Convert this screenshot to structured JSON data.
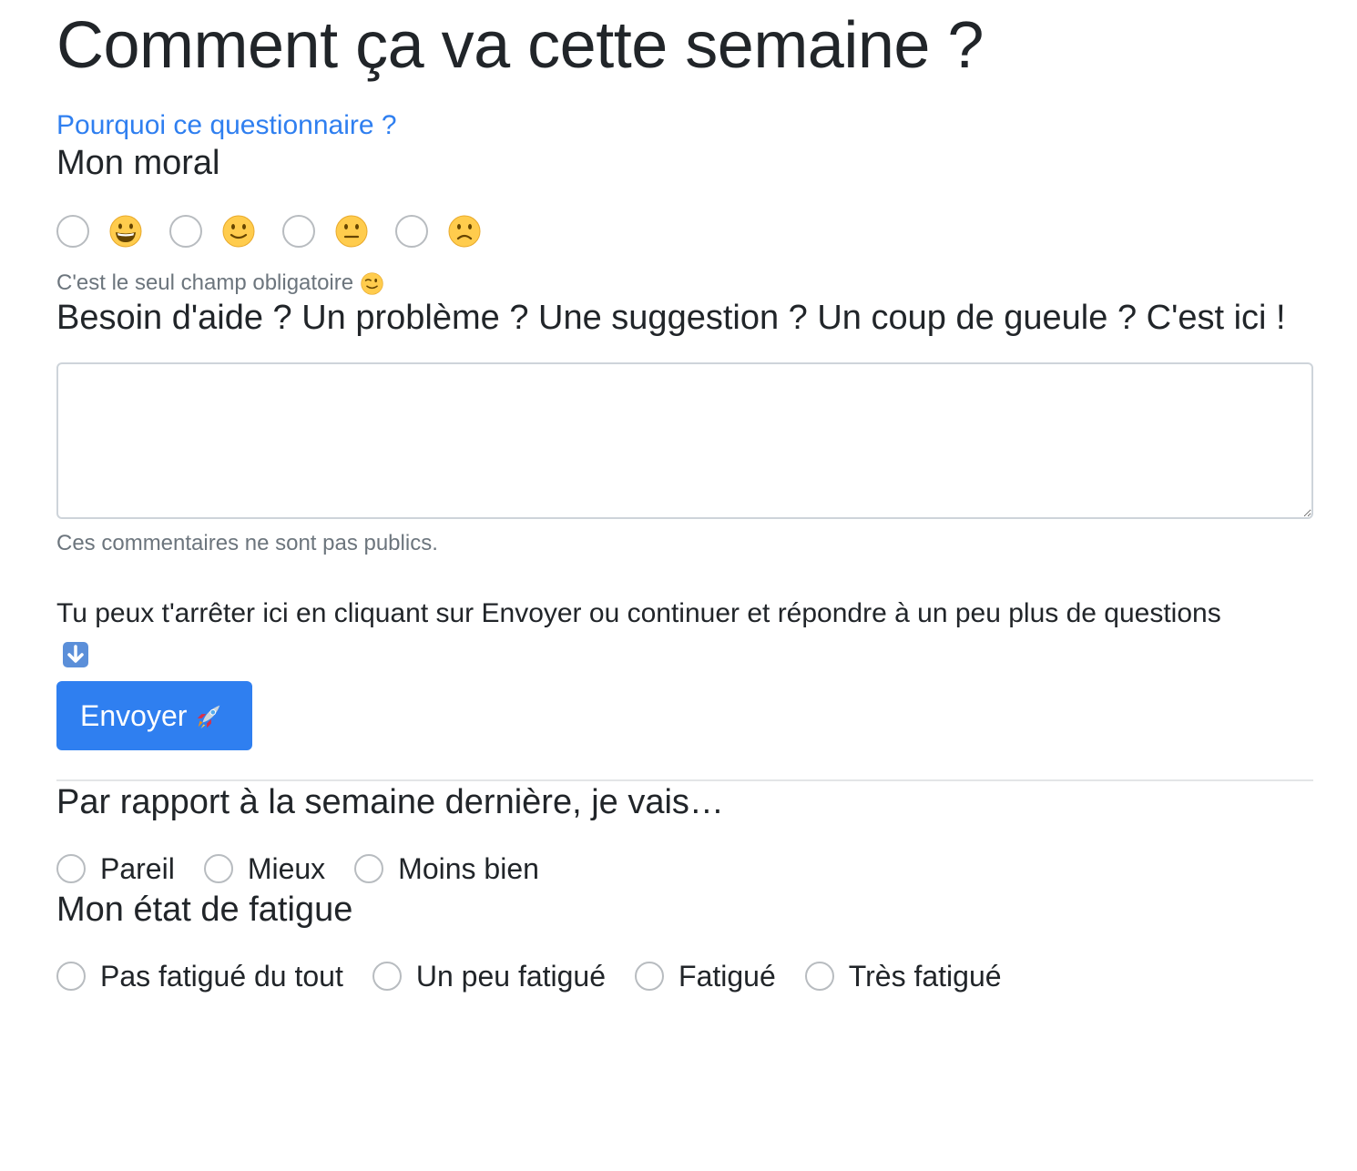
{
  "page": {
    "title": "Comment ça va cette semaine ?",
    "why_link": "Pourquoi ce questionnaire ?"
  },
  "moral": {
    "heading": "Mon moral",
    "options": [
      {
        "icon": "grinning-face-icon"
      },
      {
        "icon": "slightly-smiling-face-icon"
      },
      {
        "icon": "neutral-face-icon"
      },
      {
        "icon": "slightly-frowning-face-icon"
      }
    ],
    "help_text": "C'est le seul champ obligatoire",
    "help_icon": "winking-face-icon"
  },
  "feedback": {
    "heading": "Besoin d'aide ? Un problème ? Une suggestion ? Un coup de gueule ? C'est ici !",
    "value": "",
    "help_text": "Ces commentaires ne sont pas publics."
  },
  "continue": {
    "text": "Tu peux t'arrêter ici en cliquant sur Envoyer ou continuer et répondre à un peu plus de questions",
    "icon": "down-arrow-icon"
  },
  "submit": {
    "label": "Envoyer",
    "icon": "rocket-icon"
  },
  "comparison": {
    "heading": "Par rapport à la semaine dernière, je vais…",
    "options": [
      "Pareil",
      "Mieux",
      "Moins bien"
    ]
  },
  "fatigue": {
    "heading": "Mon état de fatigue",
    "options": [
      "Pas fatigué du tout",
      "Un peu fatigué",
      "Fatigué",
      "Très fatigué"
    ]
  },
  "colors": {
    "primary": "#2f7ff0",
    "text": "#212529",
    "muted": "#6c757d",
    "border": "#ced4da"
  }
}
